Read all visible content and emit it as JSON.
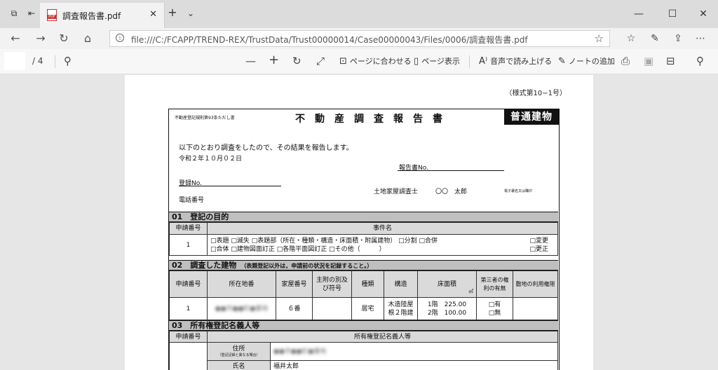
{
  "browser": {
    "tab_title": "調査報告書.pdf",
    "url": "file:///C:/FCAPP/TREND-REX/TrustData/Trust00000014/Case00000043/Files/0006/調査報告書.pdf",
    "window_controls": [
      "minimize-icon",
      "maximize-icon",
      "close-icon"
    ]
  },
  "pdf_toolbar": {
    "page_current": "",
    "page_total": "/ 4",
    "fit_page_label": "ページに合わせる",
    "page_view_label": "ページ表示",
    "read_aloud_label": "音声で読み上げる",
    "add_note_label": "ノートの追加"
  },
  "document": {
    "form_number": "（様式第10−1号）",
    "rule_ref": "不動産登記規則第93条ただし書",
    "title": "不動産調査報告書",
    "badge": "普通建物",
    "intro": "以下のとおり調査をしたので、その結果を報告します。",
    "date": "令和２年１０月０２日",
    "report_no_label": "報告書No.",
    "registration_no_label": "登録No.",
    "phone_label": "電話番号",
    "surveyor_label": "土地家屋調査士",
    "surveyor_name": "〇〇　太郎",
    "signature_note": "電子署名又は職印",
    "section1": {
      "title": "01　登記の目的",
      "col_app_no": "申請番号",
      "col_case": "事件名",
      "row_no": "1",
      "options_line1": "□表題 □滅失 □表題部（所在・種類・構造・床面積・附属建物） □分割 □合併",
      "options_line2": "□合体 □建物図面訂正 □各階平面図訂正 □その他（　　　）",
      "side_line1": "□変更",
      "side_line2": "□更正"
    },
    "section2": {
      "title": "02　調査した建物",
      "note": "（表題登記以外は，申請前の状況を記録すること。）",
      "headers": [
        "申請番号",
        "所在地番",
        "家屋番号",
        "主附の別及び符号",
        "種類",
        "構造",
        "床面積",
        "第三者の権利の有無",
        "敷地の利用権限"
      ],
      "area_unit": "㎡",
      "row": {
        "no": "1",
        "location": "●●市●●町●番地",
        "house_no": "６番",
        "kind": "居宅",
        "structure": "木造陸屋根２階建",
        "floor1": "1階　225",
        "floor1_dec": "00",
        "floor2": "2階　100",
        "floor2_dec": "00",
        "third_party_1": "□有",
        "third_party_2": "□無"
      }
    },
    "section3": {
      "title": "03　所有権登記名義人等",
      "col_app_no": "申請番号",
      "col_owner": "所有権登記名義人等",
      "address_label": "住所",
      "address_sub": "（登記記録と異なる場合）",
      "address_value": "●●市●●町●番地",
      "name_label": "氏名",
      "name_value": "福井太郎"
    }
  }
}
